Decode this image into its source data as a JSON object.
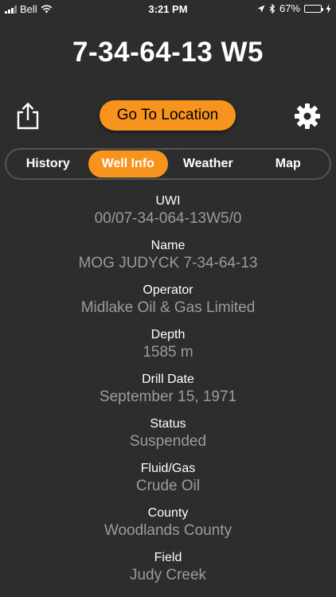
{
  "status_bar": {
    "carrier": "Bell",
    "time": "3:21 PM",
    "battery": "67%",
    "battery_level": 0.67,
    "battery_color": "#4cd964"
  },
  "well": {
    "title": "7-34-64-13 W5"
  },
  "toolbar": {
    "share_icon": "share-icon",
    "go_to_location_label": "Go To Location",
    "settings_icon": "gear-icon"
  },
  "tabs": [
    {
      "label": "History",
      "active": false
    },
    {
      "label": "Well Info",
      "active": true
    },
    {
      "label": "Weather",
      "active": false
    },
    {
      "label": "Map",
      "active": false
    }
  ],
  "fields": [
    {
      "label": "UWI",
      "value": "00/07-34-064-13W5/0"
    },
    {
      "label": "Name",
      "value": "MOG JUDYCK 7-34-64-13"
    },
    {
      "label": "Operator",
      "value": "Midlake Oil & Gas Limited"
    },
    {
      "label": "Depth",
      "value": "1585 m"
    },
    {
      "label": "Drill Date",
      "value": "September 15, 1971"
    },
    {
      "label": "Status",
      "value": "Suspended"
    },
    {
      "label": "Fluid/Gas",
      "value": "Crude Oil"
    },
    {
      "label": "County",
      "value": "Woodlands County"
    },
    {
      "label": "Field",
      "value": "Judy Creek"
    }
  ],
  "colors": {
    "accent": "#f7941d",
    "background": "#2b2b2b",
    "value_text": "#9b9b9b"
  }
}
